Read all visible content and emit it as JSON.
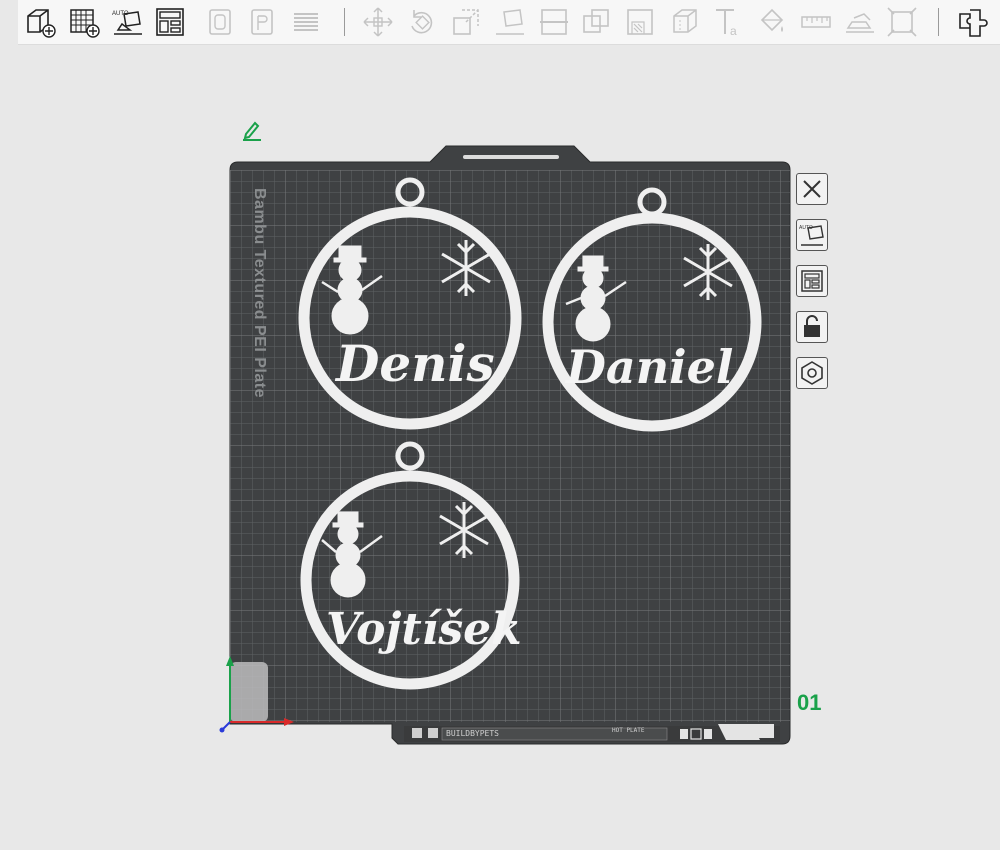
{
  "toolbar": {
    "icons": [
      "add-object-icon",
      "add-plate-icon",
      "auto-orient-icon",
      "arrange-icon",
      "split-objects-icon",
      "split-parts-icon",
      "variable-layer-icon",
      "move-icon",
      "rotate-icon",
      "scale-icon",
      "lay-on-face-icon",
      "cut-icon",
      "boolean-icon",
      "support-paint-icon",
      "seam-paint-icon",
      "text-icon",
      "color-paint-icon",
      "measure-icon",
      "assembly-icon",
      "emboss-icon",
      "assembly-view-icon"
    ]
  },
  "plate": {
    "bed_label": "Bambu Textured PEI Plate",
    "plate_number": "01",
    "footer_left": "BUILDBYPETS",
    "footer_right": "HOT PLATE"
  },
  "ornaments": [
    {
      "name": "Denis"
    },
    {
      "name": "Daniel"
    },
    {
      "name": "Vojtíšek"
    }
  ],
  "side_buttons": [
    "close-icon",
    "auto-orient-icon",
    "arrange-icon",
    "lock-icon",
    "plate-settings-icon"
  ],
  "colors": {
    "plate": "#3f4143",
    "grid": "#5b5e60",
    "ornament": "#efefef",
    "accent": "#1aa14a"
  }
}
